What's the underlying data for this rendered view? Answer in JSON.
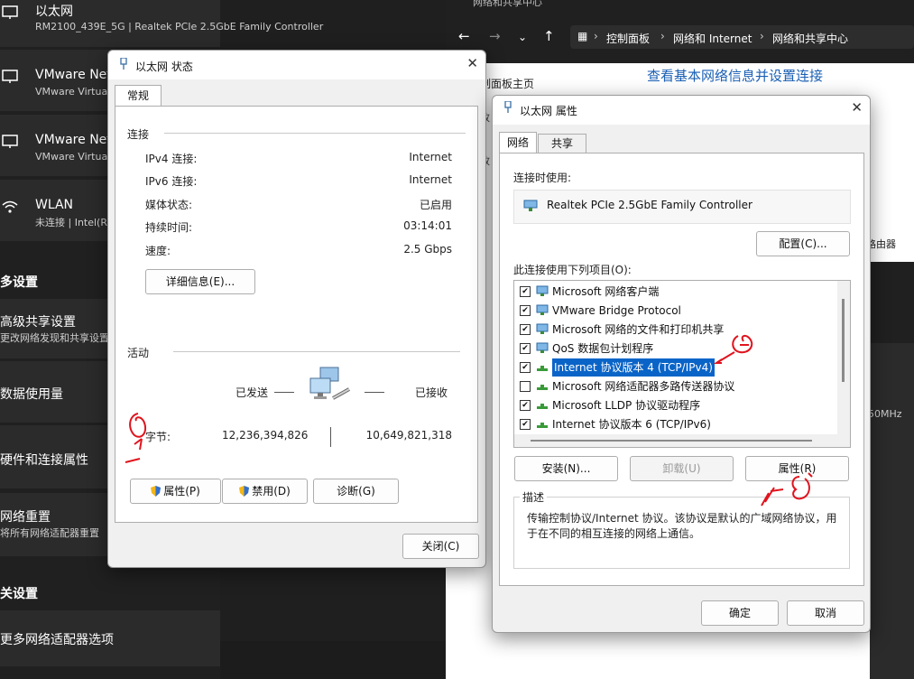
{
  "settings": {
    "items": [
      {
        "title": "以太网",
        "sub": "RM2100_439E_5G | Realtek PCIe 2.5GbE Family Controller",
        "icon": "monitor-icon"
      },
      {
        "title": "VMware Netw",
        "sub": "VMware Virtua",
        "icon": "monitor-icon"
      },
      {
        "title": "VMware Netw",
        "sub": "VMware Virtua",
        "icon": "monitor-icon"
      },
      {
        "title": "WLAN",
        "sub": "未连接 | Intel(R",
        "icon": "wifi-icon"
      }
    ],
    "section_more": "多设置",
    "advanced_sharing": {
      "title": "高级共享设置",
      "sub": "更改网络发现和共享设置"
    },
    "data_usage": "数据使用量",
    "hw_props": "硬件和连接属性",
    "net_reset": {
      "title": "网络重置",
      "sub": "将所有网络适配器重置"
    },
    "section_related": "关设置",
    "more_adapters": "更多网络适配器选项"
  },
  "explorer": {
    "window_title": "网络和共享中心",
    "breadcrumb": [
      "控制面板",
      "网络和 Internet",
      "网络和共享中心"
    ],
    "heading": "查看基本网络信息并设置连接",
    "left_home": "制面板主页",
    "side_fragment": "路由器",
    "freq_fragment": "50MHz"
  },
  "status_dialog": {
    "title": "以太网 状态",
    "tab": "常规",
    "connection_label": "连接",
    "rows": [
      {
        "k": "IPv4 连接:",
        "v": "Internet"
      },
      {
        "k": "IPv6 连接:",
        "v": "Internet"
      },
      {
        "k": "媒体状态:",
        "v": "已启用"
      },
      {
        "k": "持续时间:",
        "v": "03:14:01"
      },
      {
        "k": "速度:",
        "v": "2.5 Gbps"
      }
    ],
    "details_btn": "详细信息(E)...",
    "activity_label": "活动",
    "sent_label": "已发送",
    "received_label": "已接收",
    "bytes_label": "字节:",
    "bytes_sent": "12,236,394,826",
    "bytes_received": "10,649,821,318",
    "props_btn": "属性(P)",
    "disable_btn": "禁用(D)",
    "diagnose_btn": "诊断(G)",
    "close_btn": "关闭(C)"
  },
  "props_dialog": {
    "title": "以太网 属性",
    "tabs": [
      "网络",
      "共享"
    ],
    "connect_using_label": "连接时使用:",
    "adapter": "Realtek PCIe 2.5GbE Family Controller",
    "configure_btn": "配置(C)...",
    "items_label": "此连接使用下列项目(O):",
    "items": [
      {
        "label": "Microsoft 网络客户端",
        "checked": true,
        "icon": "network-client-icon"
      },
      {
        "label": "VMware Bridge Protocol",
        "checked": true,
        "icon": "network-client-icon"
      },
      {
        "label": "Microsoft 网络的文件和打印机共享",
        "checked": true,
        "icon": "network-client-icon"
      },
      {
        "label": "QoS 数据包计划程序",
        "checked": true,
        "icon": "network-client-icon"
      },
      {
        "label": "Internet 协议版本 4 (TCP/IPv4)",
        "checked": true,
        "icon": "protocol-icon",
        "selected": true
      },
      {
        "label": "Microsoft 网络适配器多路传送器协议",
        "checked": false,
        "icon": "protocol-icon"
      },
      {
        "label": "Microsoft LLDP 协议驱动程序",
        "checked": true,
        "icon": "protocol-icon"
      },
      {
        "label": "Internet 协议版本 6 (TCP/IPv6)",
        "checked": true,
        "icon": "protocol-icon"
      }
    ],
    "install_btn": "安装(N)...",
    "uninstall_btn": "卸载(U)",
    "properties_btn": "属性(R)",
    "desc_label": "描述",
    "description": "传输控制协议/Internet 协议。该协议是默认的广域网络协议，用于在不同的相互连接的网络上通信。",
    "ok_btn": "确定",
    "cancel_btn": "取消"
  },
  "colors": {
    "selection": "#0a64c8",
    "annotation": "#e0141e",
    "link": "#1a5fb4"
  }
}
